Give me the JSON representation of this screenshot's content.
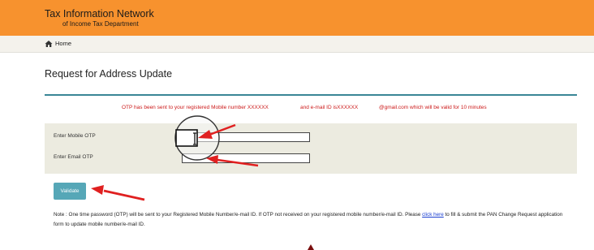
{
  "header": {
    "title": "Tax Information Network",
    "subtitle": "of Income Tax Department"
  },
  "breadcrumb": {
    "home_label": "Home",
    "home_icon": "home-icon"
  },
  "page": {
    "title": "Request for Address Update"
  },
  "otp_message": {
    "part1": "OTP has been sent to your registered Mobile number XXXXXX",
    "part2": "and e-mail ID isXXXXXX",
    "part3": "@gmail.com which will be valid for 10 minutes",
    "color": "#cc1a1a"
  },
  "form": {
    "mobile_otp_label": "Enter Mobile OTP",
    "mobile_otp_value": "",
    "email_otp_label": "Enter Email OTP",
    "email_otp_value": ""
  },
  "validate_button": {
    "label": "Validate",
    "color": "#56a7b7"
  },
  "note": {
    "text_before_link": "Note : One time password (OTP) will be sent to your Registered Mobile Number/e-mail ID. If OTP not received on your registered mobile number/e-mail ID. Please",
    "link_text": "click here",
    "text_after_link": "to fill & submit the PAN Change Request application form to update mobile number/e-mail ID."
  },
  "colors": {
    "header_bg": "#f7922e",
    "accent_rule": "#3a8696",
    "annotation_arrow": "#e02020"
  }
}
